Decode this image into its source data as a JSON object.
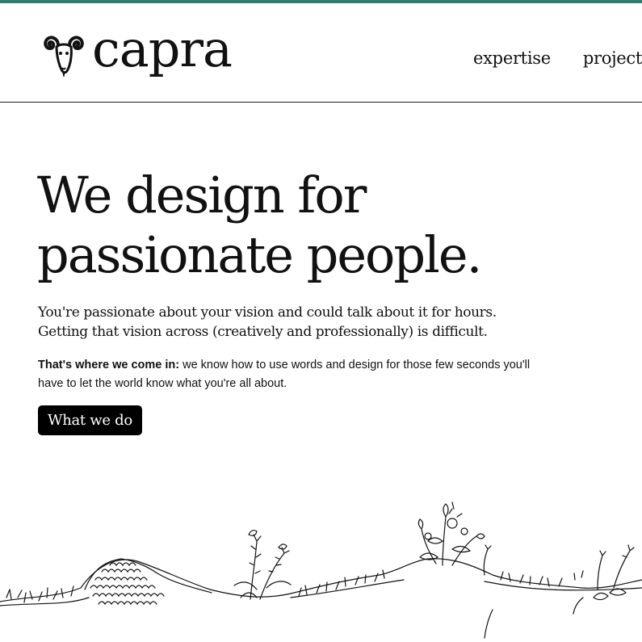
{
  "brand": {
    "name": "capra",
    "accent_color": "#2e7d6e",
    "logo_icon": "ram-head-icon"
  },
  "nav": {
    "items": [
      {
        "label": "expertise"
      },
      {
        "label": "projects"
      }
    ]
  },
  "hero": {
    "title_line1": "We design for",
    "title_line2": "passionate people.",
    "lead_line1": "You're passionate about your vision and could talk about it for hours.",
    "lead_line2": "Getting that vision across (creatively and professionally) is difficult.",
    "pitch_strong": "That's where we come in:",
    "pitch_text": " we know how to use words and design for those few seconds you'll have to let the world know what you're all about.",
    "cta_label": "What we do"
  },
  "illustration": {
    "icon": "hillside-plants-illustration"
  }
}
